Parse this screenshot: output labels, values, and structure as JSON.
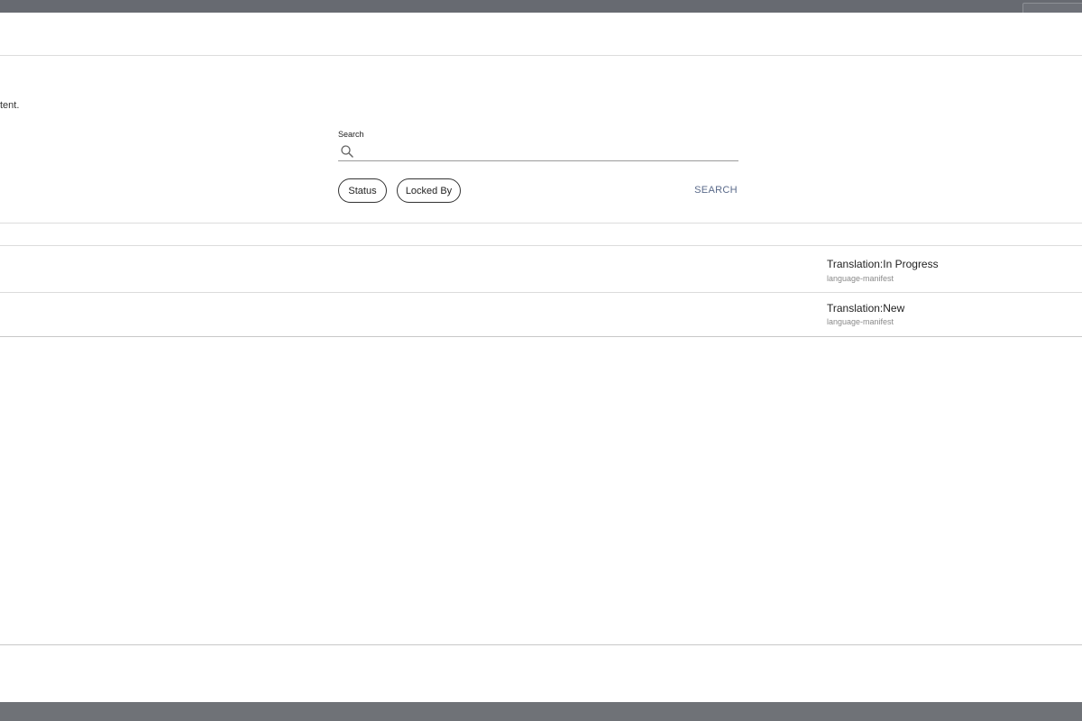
{
  "description": "tent.",
  "search": {
    "label": "Search",
    "value": "",
    "placeholder": ""
  },
  "filters": [
    {
      "label": "Status"
    },
    {
      "label": "Locked By"
    }
  ],
  "search_button": "SEARCH",
  "results": [
    {
      "title": "Translation:In Progress",
      "subtitle": "language-manifest"
    },
    {
      "title": "Translation:New",
      "subtitle": "language-manifest"
    }
  ],
  "icons": {
    "search": "search-icon"
  },
  "colors": {
    "accent": "#5a6a8a",
    "overlay": "#6b6e74"
  }
}
